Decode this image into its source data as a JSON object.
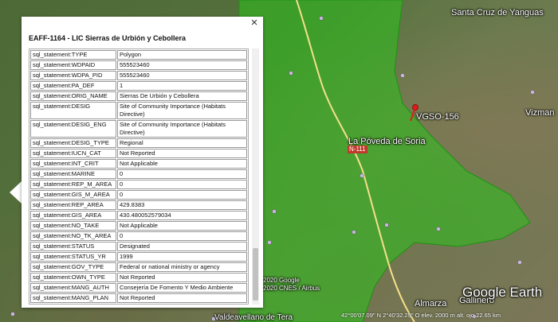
{
  "map": {
    "places": [
      {
        "label": "Santa Cruz de Yanguas"
      },
      {
        "label": "VGSO-156"
      },
      {
        "label": "La Póveda de Soria"
      },
      {
        "label": "N-111"
      },
      {
        "label": "Vizman"
      },
      {
        "label": "Almarza"
      },
      {
        "label": "Gallinero"
      },
      {
        "label": "Valdeavellano de Tera"
      }
    ],
    "attribution_1": "2020 Google",
    "attribution_2": "2020 CNES / Airbus",
    "brand": "Google Earth",
    "status_bar": "42°00'07.09\" N   2°40'32.29\" O   elev. 2000 m   alt. ojo 22.65 km"
  },
  "popup": {
    "title": "EAFF-1164 - LIC Sierras de Urbión y Cebollera",
    "close_glyph": "×",
    "rows": [
      {
        "key": "sql_statement:TYPE",
        "value": "Polygon"
      },
      {
        "key": "sql_statement:WDPAID",
        "value": "555523460"
      },
      {
        "key": "sql_statement:WDPA_PID",
        "value": "555523460"
      },
      {
        "key": "sql_statement:PA_DEF",
        "value": "1"
      },
      {
        "key": "sql_statement:ORIG_NAME",
        "value": "Sierras De Urbión y Cebollera"
      },
      {
        "key": "sql_statement:DESIG",
        "value": "Site of Community Importance (Habitats Directive)"
      },
      {
        "key": "sql_statement:DESIG_ENG",
        "value": "Site of Community Importance (Habitats Directive)"
      },
      {
        "key": "sql_statement:DESIG_TYPE",
        "value": "Regional"
      },
      {
        "key": "sql_statement:IUCN_CAT",
        "value": "Not Reported"
      },
      {
        "key": "sql_statement:INT_CRIT",
        "value": "Not Applicable"
      },
      {
        "key": "sql_statement:MARINE",
        "value": "0"
      },
      {
        "key": "sql_statement:REP_M_AREA",
        "value": "0"
      },
      {
        "key": "sql_statement:GIS_M_AREA",
        "value": "0"
      },
      {
        "key": "sql_statement:REP_AREA",
        "value": "429.8383"
      },
      {
        "key": "sql_statement:GIS_AREA",
        "value": "430.480052579034"
      },
      {
        "key": "sql_statement:NO_TAKE",
        "value": "Not Applicable"
      },
      {
        "key": "sql_statement:NO_TK_AREA",
        "value": "0"
      },
      {
        "key": "sql_statement:STATUS",
        "value": "Designated"
      },
      {
        "key": "sql_statement:STATUS_YR",
        "value": "1999"
      },
      {
        "key": "sql_statement:GOV_TYPE",
        "value": "Federal or national ministry or agency"
      },
      {
        "key": "sql_statement:OWN_TYPE",
        "value": "Not Reported"
      },
      {
        "key": "sql_statement:MANG_AUTH",
        "value": "Consejería De Fomento Y Medio Ambiente"
      },
      {
        "key": "sql_statement:MANG_PLAN",
        "value": "Not Reported"
      }
    ]
  }
}
